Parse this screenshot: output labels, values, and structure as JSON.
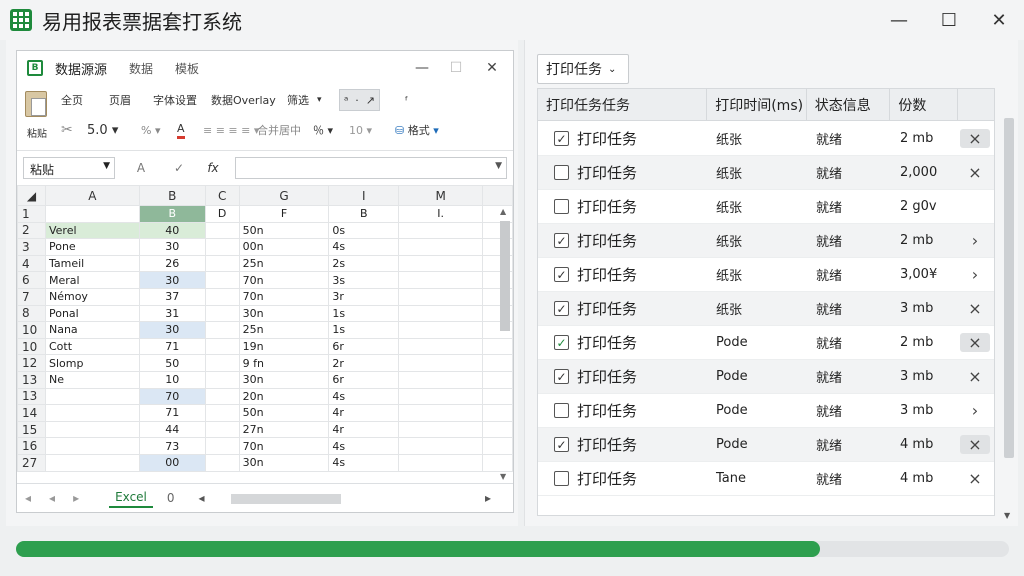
{
  "app": {
    "title": "易用报表票据套打系统"
  },
  "excel": {
    "title": "数据源源",
    "tabs": [
      "数据",
      "模板"
    ],
    "ribbon": {
      "row1": [
        "全页",
        "页眉",
        "字体设置",
        "数据Overlay",
        "筛选",
        "ᵃ",
        "ᶠ"
      ],
      "row2": [
        "粘贴",
        "5.0",
        "%",
        "A",
        "合并居中",
        "％",
        "10",
        "格式"
      ]
    },
    "namebox": "粘贴",
    "col_headers": [
      "",
      "A",
      "B",
      "C",
      "G",
      "I",
      "M"
    ],
    "rows": [
      {
        "n": "1",
        "a": "",
        "b": "B",
        "c": "D",
        "g": "F",
        "i": "B",
        "m": "I."
      },
      {
        "n": "2",
        "a": "Verel",
        "b": "40",
        "c": "",
        "g": "50n",
        "i": "0s",
        "m": ""
      },
      {
        "n": "3",
        "a": "Pone",
        "b": "30",
        "c": "",
        "g": "00n",
        "i": "4s",
        "m": ""
      },
      {
        "n": "4",
        "a": "Tameil",
        "b": "26",
        "c": "",
        "g": "25n",
        "i": "2s",
        "m": ""
      },
      {
        "n": "6",
        "a": "Meral",
        "b": "30",
        "c": "",
        "g": "70n",
        "i": "3s",
        "m": ""
      },
      {
        "n": "7",
        "a": "Némoy",
        "b": "37",
        "c": "",
        "g": "70n",
        "i": "3r",
        "m": ""
      },
      {
        "n": "8",
        "a": "Ponal",
        "b": "31",
        "c": "",
        "g": "30n",
        "i": "1s",
        "m": ""
      },
      {
        "n": "10",
        "a": "Nana",
        "b": "30",
        "c": "",
        "g": "25n",
        "i": "1s",
        "m": ""
      },
      {
        "n": "10",
        "a": "Cott",
        "b": "71",
        "c": "",
        "g": "19n",
        "i": "6r",
        "m": ""
      },
      {
        "n": "12",
        "a": "Slomp",
        "b": "50",
        "c": "",
        "g": "9 fn",
        "i": "2r",
        "m": ""
      },
      {
        "n": "13",
        "a": "Ne",
        "b": "10",
        "c": "",
        "g": "30n",
        "i": "6r",
        "m": ""
      },
      {
        "n": "13",
        "a": "",
        "b": "70",
        "c": "",
        "g": "20n",
        "i": "4s",
        "m": ""
      },
      {
        "n": "14",
        "a": "",
        "b": "71",
        "c": "",
        "g": "50n",
        "i": "4r",
        "m": ""
      },
      {
        "n": "15",
        "a": "",
        "b": "44",
        "c": "",
        "g": "27n",
        "i": "4r",
        "m": ""
      },
      {
        "n": "16",
        "a": "",
        "b": "73",
        "c": "",
        "g": "70n",
        "i": "4s",
        "m": ""
      },
      {
        "n": "27",
        "a": "",
        "b": "00",
        "c": "",
        "g": "30n",
        "i": "4s",
        "m": ""
      }
    ],
    "sheet_tab": "Excel",
    "sheet_tab2": "0"
  },
  "tasks": {
    "dropdown": "打印任务",
    "headers": [
      "打印任务任务",
      "打印时间(ms)",
      "状态信息",
      "份数"
    ],
    "rows": [
      {
        "checked": true,
        "name": "打印任务",
        "c2": "纸张",
        "c3": "就绪",
        "c4": "2 mb",
        "action": "×",
        "boxed": true
      },
      {
        "checked": false,
        "name": "打印任务",
        "c2": "纸张",
        "c3": "就绪",
        "c4": "2,000",
        "action": "×",
        "boxed": false
      },
      {
        "checked": false,
        "name": "打印任务",
        "c2": "纸张",
        "c3": "就绪",
        "c4": "2 g0v",
        "action": "",
        "boxed": false
      },
      {
        "checked": true,
        "name": "打印任务",
        "c2": "纸张",
        "c3": "就绪",
        "c4": "2 mb",
        "action": "›",
        "boxed": false
      },
      {
        "checked": true,
        "name": "打印任务",
        "c2": "纸张",
        "c3": "就绪",
        "c4": "3,00¥",
        "action": "›",
        "boxed": false
      },
      {
        "checked": true,
        "name": "打印任务",
        "c2": "纸张",
        "c3": "就绪",
        "c4": "3 mb",
        "action": "×",
        "boxed": false
      },
      {
        "checked": true,
        "name": "打印任务",
        "c2": "Pode",
        "c3": "就绪",
        "c4": "2 mb",
        "action": "×",
        "boxed": true
      },
      {
        "checked": true,
        "name": "打印任务",
        "c2": "Pode",
        "c3": "就绪",
        "c4": "3 mb",
        "action": "×",
        "boxed": false
      },
      {
        "checked": false,
        "name": "打印任务",
        "c2": "Pode",
        "c3": "就绪",
        "c4": "3 mb",
        "action": "›",
        "boxed": false
      },
      {
        "checked": true,
        "name": "打印任务",
        "c2": "Pode",
        "c3": "就绪",
        "c4": "4 mb",
        "action": "×",
        "boxed": true
      },
      {
        "checked": false,
        "name": "打印任务",
        "c2": "Tane",
        "c3": "就绪",
        "c4": "4 mb",
        "action": "×",
        "boxed": false
      }
    ]
  },
  "progress": {
    "value": 0.81
  },
  "colors": {
    "accent": "#1e8a3c",
    "progress": "#2e9f4f"
  }
}
